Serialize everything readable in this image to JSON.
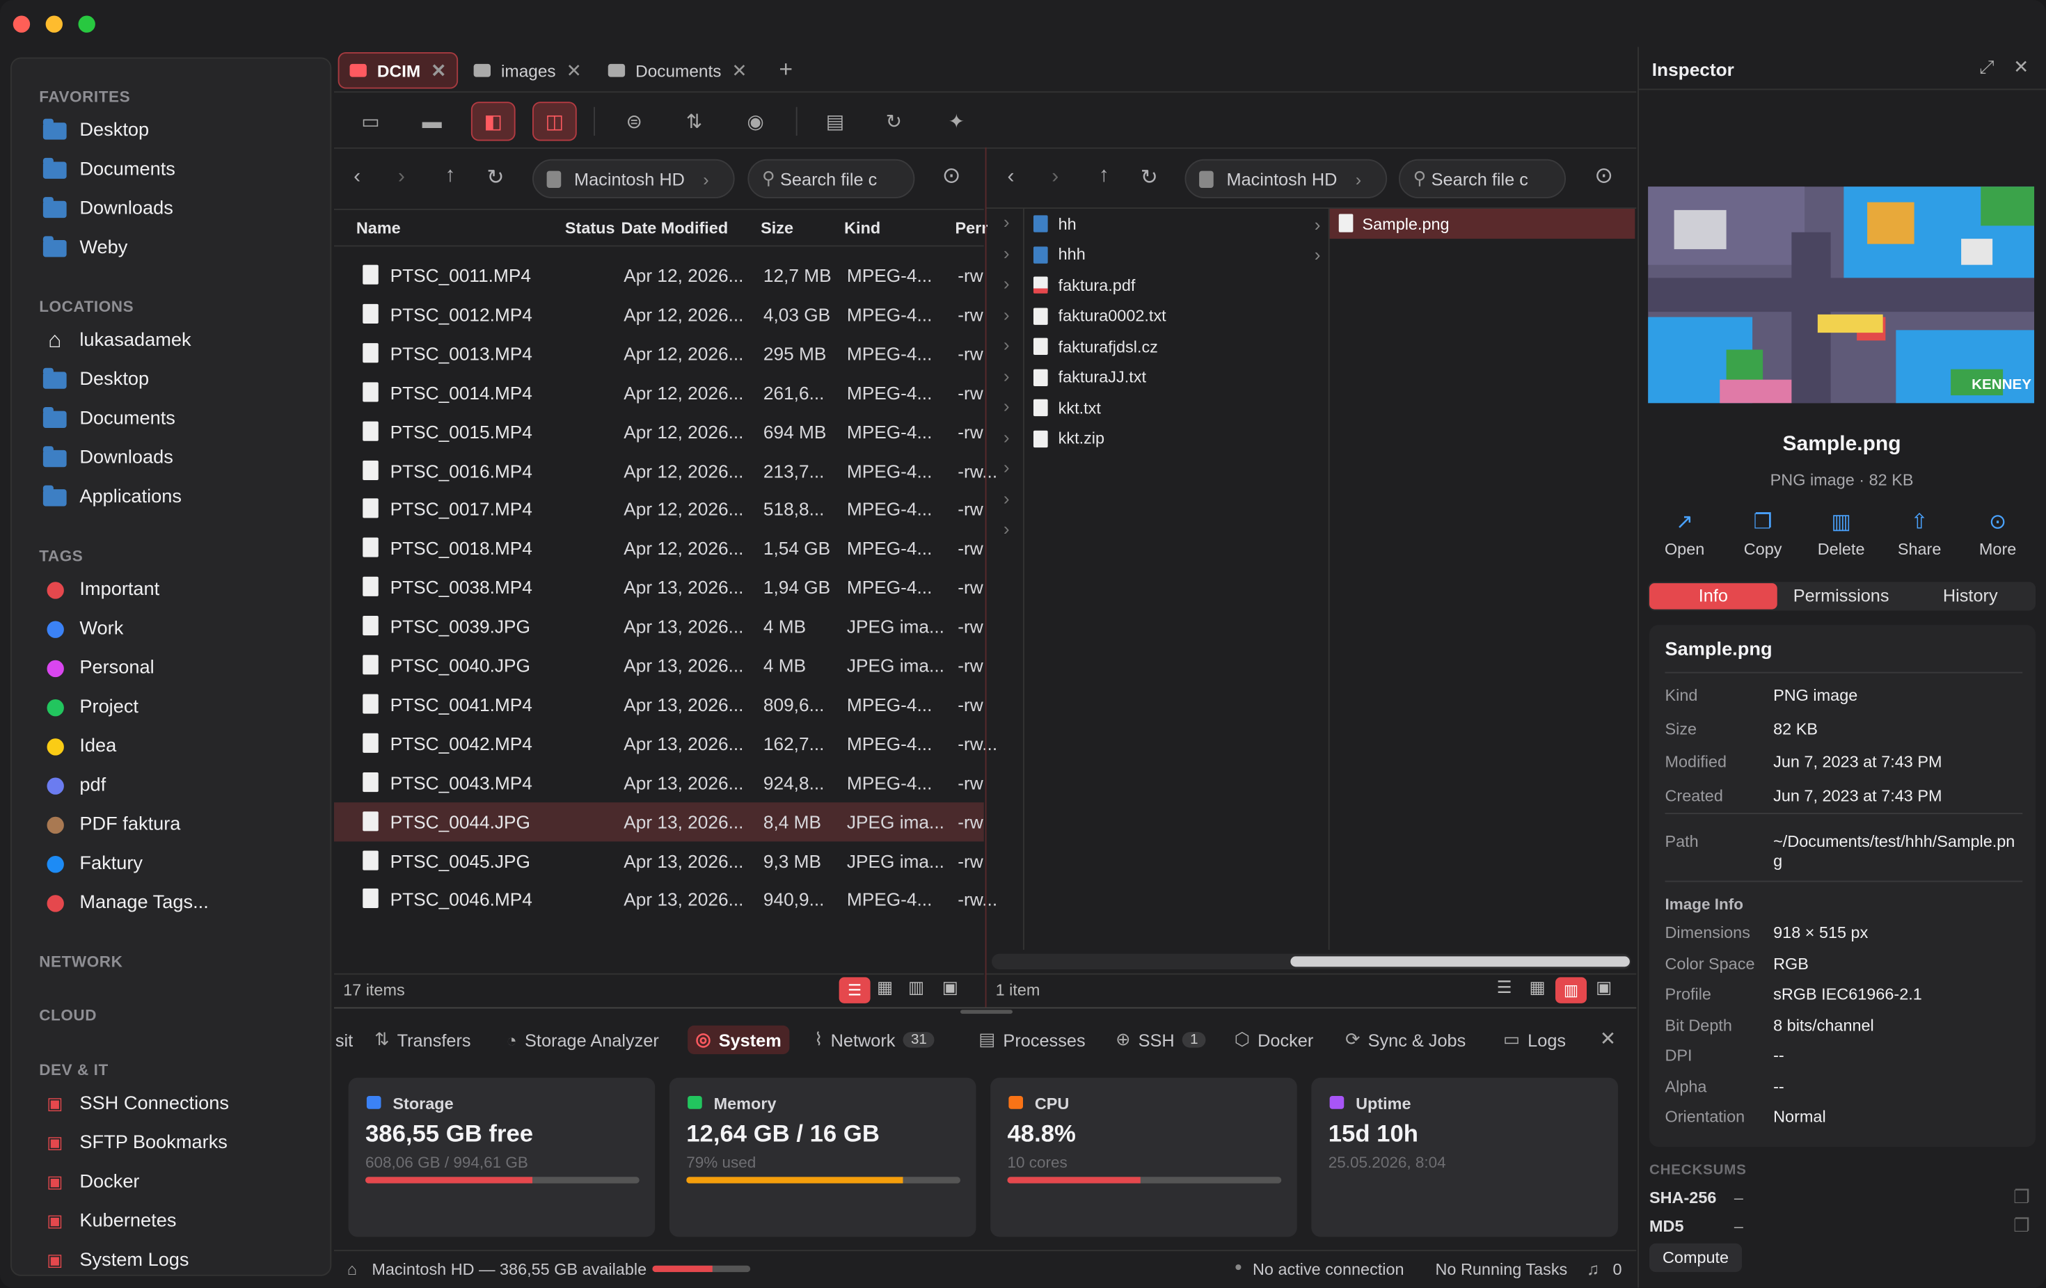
{
  "window": {
    "traffic": [
      "#ff5f57",
      "#febc2e",
      "#28c840"
    ]
  },
  "sidebar": {
    "favorites_title": "FAVORITES",
    "favorites": [
      "Desktop",
      "Documents",
      "Downloads",
      "Weby"
    ],
    "locations_title": "LOCATIONS",
    "locations": [
      "lukasadamek",
      "Desktop",
      "Documents",
      "Downloads",
      "Applications"
    ],
    "tags_title": "TAGS",
    "tags": [
      {
        "label": "Important",
        "color": "#e5484d"
      },
      {
        "label": "Work",
        "color": "#3b82f6"
      },
      {
        "label": "Personal",
        "color": "#d946ef"
      },
      {
        "label": "Project",
        "color": "#22c55e"
      },
      {
        "label": "Idea",
        "color": "#facc15"
      },
      {
        "label": "pdf",
        "color": "#6b7cf0"
      },
      {
        "label": "PDF faktura",
        "color": "#a97952"
      },
      {
        "label": "Faktury",
        "color": "#1d8bf5"
      },
      {
        "label": "Manage Tags...",
        "color": "#e5484d"
      }
    ],
    "network_title": "NETWORK",
    "cloud_title": "CLOUD",
    "devit_title": "DEV & IT",
    "devit": [
      "SSH Connections",
      "SFTP Bookmarks",
      "Docker",
      "Kubernetes",
      "System Logs"
    ]
  },
  "tabs": [
    {
      "label": "DCIM",
      "active": true
    },
    {
      "label": "images"
    },
    {
      "label": "Documents"
    }
  ],
  "left_pane": {
    "crumb": "Macintosh HD",
    "search_placeholder": "Search file c",
    "columns": [
      "Name",
      "Status",
      "Date Modified",
      "Size",
      "Kind",
      "Perr"
    ],
    "files": [
      [
        "PTSC_0011.MP4",
        "Apr 12, 2026...",
        "12,7 MB",
        "MPEG-4...",
        "-rw"
      ],
      [
        "PTSC_0012.MP4",
        "Apr 12, 2026...",
        "4,03 GB",
        "MPEG-4...",
        "-rw"
      ],
      [
        "PTSC_0013.MP4",
        "Apr 12, 2026...",
        "295 MB",
        "MPEG-4...",
        "-rw"
      ],
      [
        "PTSC_0014.MP4",
        "Apr 12, 2026...",
        "261,6...",
        "MPEG-4...",
        "-rw"
      ],
      [
        "PTSC_0015.MP4",
        "Apr 12, 2026...",
        "694 MB",
        "MPEG-4...",
        "-rw"
      ],
      [
        "PTSC_0016.MP4",
        "Apr 12, 2026...",
        "213,7...",
        "MPEG-4...",
        "-rw..."
      ],
      [
        "PTSC_0017.MP4",
        "Apr 12, 2026...",
        "518,8...",
        "MPEG-4...",
        "-rw"
      ],
      [
        "PTSC_0018.MP4",
        "Apr 12, 2026...",
        "1,54 GB",
        "MPEG-4...",
        "-rw"
      ],
      [
        "PTSC_0038.MP4",
        "Apr 13, 2026...",
        "1,94 GB",
        "MPEG-4...",
        "-rw"
      ],
      [
        "PTSC_0039.JPG",
        "Apr 13, 2026...",
        "4 MB",
        "JPEG ima...",
        "-rw"
      ],
      [
        "PTSC_0040.JPG",
        "Apr 13, 2026...",
        "4 MB",
        "JPEG ima...",
        "-rw"
      ],
      [
        "PTSC_0041.MP4",
        "Apr 13, 2026...",
        "809,6...",
        "MPEG-4...",
        "-rw"
      ],
      [
        "PTSC_0042.MP4",
        "Apr 13, 2026...",
        "162,7...",
        "MPEG-4...",
        "-rw..."
      ],
      [
        "PTSC_0043.MP4",
        "Apr 13, 2026...",
        "924,8...",
        "MPEG-4...",
        "-rw"
      ],
      [
        "PTSC_0044.JPG",
        "Apr 13, 2026...",
        "8,4 MB",
        "JPEG ima...",
        "-rw"
      ],
      [
        "PTSC_0045.JPG",
        "Apr 13, 2026...",
        "9,3 MB",
        "JPEG ima...",
        "-rw"
      ],
      [
        "PTSC_0046.MP4",
        "Apr 13, 2026...",
        "940,9...",
        "MPEG-4...",
        "-rw..."
      ]
    ],
    "selected": 14,
    "status": "17 items"
  },
  "right_pane": {
    "crumb": "Macintosh HD",
    "search_placeholder": "Search file c",
    "items": [
      {
        "name": "hh",
        "folder": true
      },
      {
        "name": "hhh",
        "folder": true
      },
      {
        "name": "faktura.pdf",
        "pdf": true
      },
      {
        "name": "faktura0002.txt"
      },
      {
        "name": "fakturafjdsl.cz"
      },
      {
        "name": "fakturaJJ.txt"
      },
      {
        "name": "kkt.txt"
      },
      {
        "name": "kkt.zip"
      }
    ],
    "preview_item": "Sample.png",
    "status": "1 item"
  },
  "bottom": {
    "tabs": [
      "sit",
      "Transfers",
      "Storage Analyzer",
      "System",
      "Network",
      "Processes",
      "SSH",
      "Docker",
      "Sync & Jobs",
      "Logs"
    ],
    "network_badge": "31",
    "ssh_badge": "1",
    "cards": [
      {
        "title": "Storage",
        "value": "386,55 GB free",
        "sub": "608,06 GB / 994,61 GB",
        "fill": 0.61,
        "color": "#e5484d",
        "icon": "#3b82f6"
      },
      {
        "title": "Memory",
        "value": "12,64 GB / 16 GB",
        "sub": "79% used",
        "fill": 0.79,
        "color": "#f59e0b",
        "icon": "#22c55e"
      },
      {
        "title": "CPU",
        "value": "48.8%",
        "sub": "10 cores",
        "fill": 0.488,
        "color": "#e5484d",
        "icon": "#f97316"
      },
      {
        "title": "Uptime",
        "value": "15d 10h",
        "sub": "25.05.2026, 8:04",
        "fill": 0,
        "color": "#000",
        "icon": "#a855f7"
      }
    ]
  },
  "statusbar": {
    "disk": "Macintosh HD — 386,55 GB available",
    "disk_fill": 0.61,
    "connection": "No active connection",
    "tasks": "No Running Tasks",
    "notifications": "0"
  },
  "inspector": {
    "title": "Inspector",
    "file": "Sample.png",
    "subtitle": "PNG image · 82 KB",
    "actions": [
      "Open",
      "Copy",
      "Delete",
      "Share",
      "More"
    ],
    "tabs": [
      "Info",
      "Permissions",
      "History"
    ],
    "section_title": "Sample.png",
    "props": [
      [
        "Kind",
        "PNG image"
      ],
      [
        "Size",
        "82 KB"
      ],
      [
        "Modified",
        "Jun 7, 2023 at 7:43 PM"
      ],
      [
        "Created",
        "Jun 7, 2023 at 7:43 PM"
      ]
    ],
    "path_label": "Path",
    "path": "~/Documents/test/hhh/Sample.pn g",
    "image_info_title": "Image Info",
    "image_props": [
      [
        "Dimensions",
        "918 × 515 px"
      ],
      [
        "Color Space",
        "RGB"
      ],
      [
        "Profile",
        "sRGB IEC61966-2.1"
      ],
      [
        "Bit Depth",
        "8 bits/channel"
      ],
      [
        "DPI",
        "--"
      ],
      [
        "Alpha",
        "--"
      ],
      [
        "Orientation",
        "Normal"
      ]
    ],
    "checksums_title": "CHECKSUMS",
    "checksums": [
      [
        "SHA-256",
        "–"
      ],
      [
        "MD5",
        "–"
      ]
    ],
    "compute": "Compute",
    "preview_watermark": "KENNEY"
  }
}
